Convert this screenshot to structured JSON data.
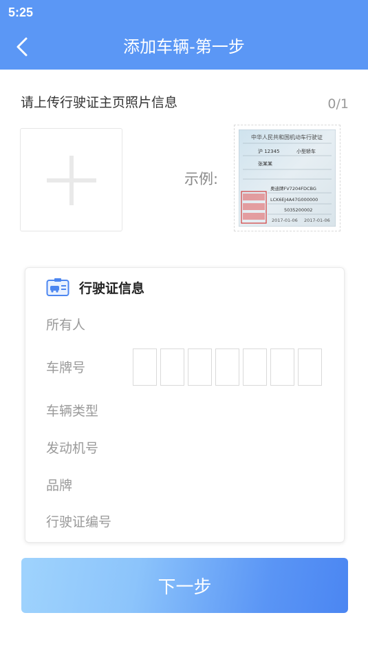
{
  "status_bar": {
    "time": "5:25"
  },
  "nav": {
    "title": "添加车辆-第一步",
    "back_icon": "chevron-left-icon"
  },
  "upload": {
    "title": "请上传行驶证主页照片信息",
    "count": "0/1",
    "add_icon": "plus-icon",
    "example_label": "示例:",
    "example_card": {
      "heading": "中华人民共和国机动车行驶证",
      "plate": "沪 12345",
      "vehicle_type": "小型轿车",
      "owner": "张某某",
      "model": "奥迪牌FV7204FDCBG",
      "vin": "LCK6EJ4A47G000000",
      "engine_no": "5035200002",
      "date": "2017-01-06"
    }
  },
  "card": {
    "icon": "vehicle-license-icon",
    "title": "行驶证信息",
    "fields": {
      "owner": "所有人",
      "plate": "车牌号",
      "vehicle_type": "车辆类型",
      "engine_no": "发动机号",
      "brand": "品牌",
      "license_no": "行驶证编号"
    },
    "plate_chars": [
      "",
      "",
      "",
      "",
      "",
      "",
      ""
    ]
  },
  "next_button": {
    "label": "下一步"
  },
  "colors": {
    "primary": "#5b97f5",
    "gradient_start": "#9fd3fd",
    "gradient_end": "#4b86f2"
  }
}
